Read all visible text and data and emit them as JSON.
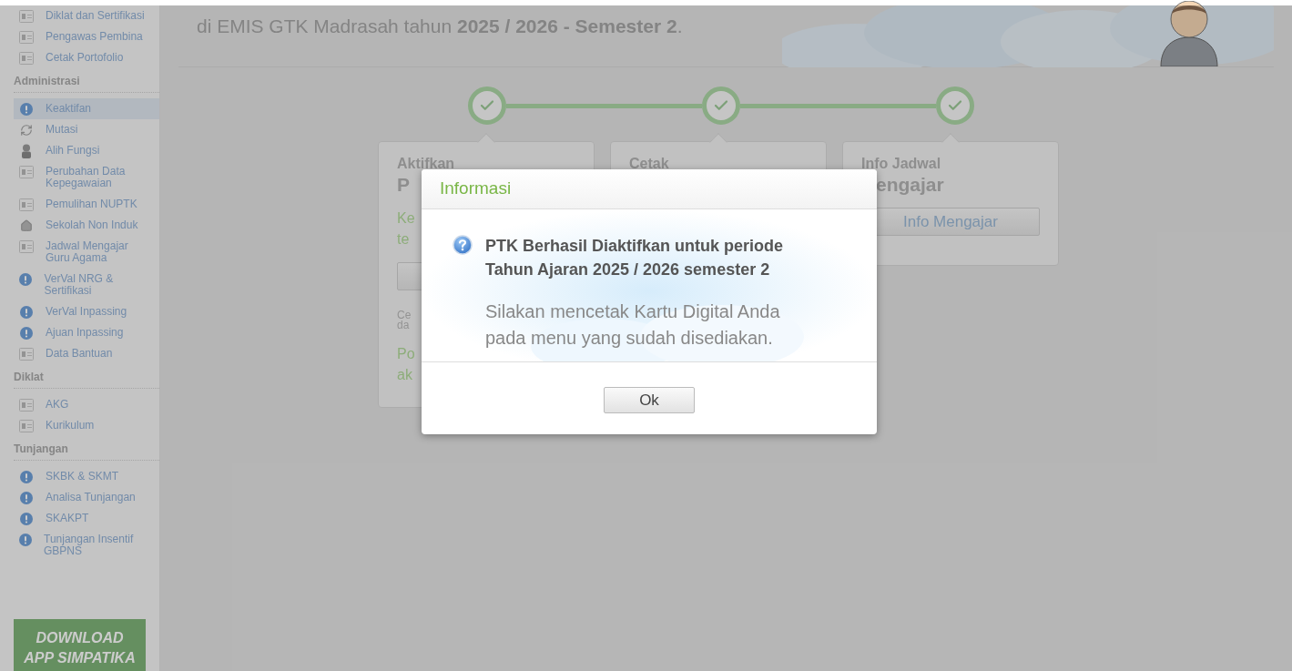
{
  "sidebar": {
    "sections": [
      {
        "items": [
          {
            "label": "Diklat dan Sertifikasi",
            "kind": "card",
            "selected": false
          },
          {
            "label": "Pengawas Pembina",
            "kind": "card",
            "selected": false
          },
          {
            "label": "Cetak Portofolio",
            "kind": "card",
            "selected": false
          }
        ]
      },
      {
        "title": "Administrasi",
        "items": [
          {
            "label": "Keaktifan",
            "kind": "alert",
            "selected": true
          },
          {
            "label": "Mutasi",
            "kind": "refresh",
            "selected": false
          },
          {
            "label": "Alih Fungsi",
            "kind": "person",
            "selected": false
          },
          {
            "label": "Perubahan Data Kepegawaian",
            "kind": "card",
            "selected": false
          },
          {
            "label": "Pemulihan NUPTK",
            "kind": "card",
            "selected": false
          },
          {
            "label": "Sekolah Non Induk",
            "kind": "house",
            "selected": false
          },
          {
            "label": "Jadwal Mengajar Guru Agama",
            "kind": "card",
            "selected": false
          },
          {
            "label": "VerVal NRG & Sertifikasi",
            "kind": "alert",
            "selected": false
          },
          {
            "label": "VerVal Inpassing",
            "kind": "alert",
            "selected": false
          },
          {
            "label": "Ajuan Inpassing",
            "kind": "alert",
            "selected": false
          },
          {
            "label": "Data Bantuan",
            "kind": "card",
            "selected": false
          }
        ]
      },
      {
        "title": "Diklat",
        "items": [
          {
            "label": "AKG",
            "kind": "card",
            "selected": false
          },
          {
            "label": "Kurikulum",
            "kind": "card",
            "selected": false
          }
        ]
      },
      {
        "title": "Tunjangan",
        "items": [
          {
            "label": "SKBK & SKMT",
            "kind": "alert",
            "selected": false
          },
          {
            "label": "Analisa Tunjangan",
            "kind": "alert",
            "selected": false
          },
          {
            "label": "SKAKPT",
            "kind": "alert",
            "selected": false
          },
          {
            "label": "Tunjangan Insentif GBPNS",
            "kind": "alert",
            "selected": false
          }
        ]
      }
    ],
    "download_button": {
      "lines": [
        "DOWNLOAD",
        "APP SIMPATIKA"
      ]
    }
  },
  "header": {
    "text": "di EMIS GTK Madrasah tahun **2025 / 2026 - Semester 2**."
  },
  "steps": [
    {
      "done": true
    },
    {
      "done": true
    },
    {
      "done": true
    }
  ],
  "cards": [
    {
      "blocks": [
        {
          "kind": "title",
          "lines": [
            "Aktifkan"
          ]
        },
        {
          "kind": "heading",
          "lines": [
            "P"
          ]
        },
        {
          "kind": "note",
          "lines": [
            "Ke",
            "te"
          ]
        },
        {
          "kind": "button"
        },
        {
          "kind": "small",
          "lines": [
            "Ce",
            "da"
          ]
        },
        {
          "kind": "note",
          "lines": [
            "Po",
            "ak"
          ]
        }
      ]
    },
    {
      "blocks": [
        {
          "kind": "title",
          "lines": [
            "Cetak"
          ]
        }
      ]
    },
    {
      "blocks": [
        {
          "kind": "title",
          "lines": [
            "Info Jadwal"
          ]
        },
        {
          "kind": "heading",
          "lines": [
            "engajar"
          ]
        },
        {
          "kind": "button",
          "label": "Info Mengajar"
        }
      ]
    }
  ],
  "dialog": {
    "title": "Informasi",
    "message": "PTK Berhasil Diaktifkan untuk periode Tahun Ajaran 2025 / 2026 semester 2",
    "note": "Silakan mencetak Kartu Digital Anda pada menu yang sudah disediakan.",
    "button": "Ok"
  }
}
